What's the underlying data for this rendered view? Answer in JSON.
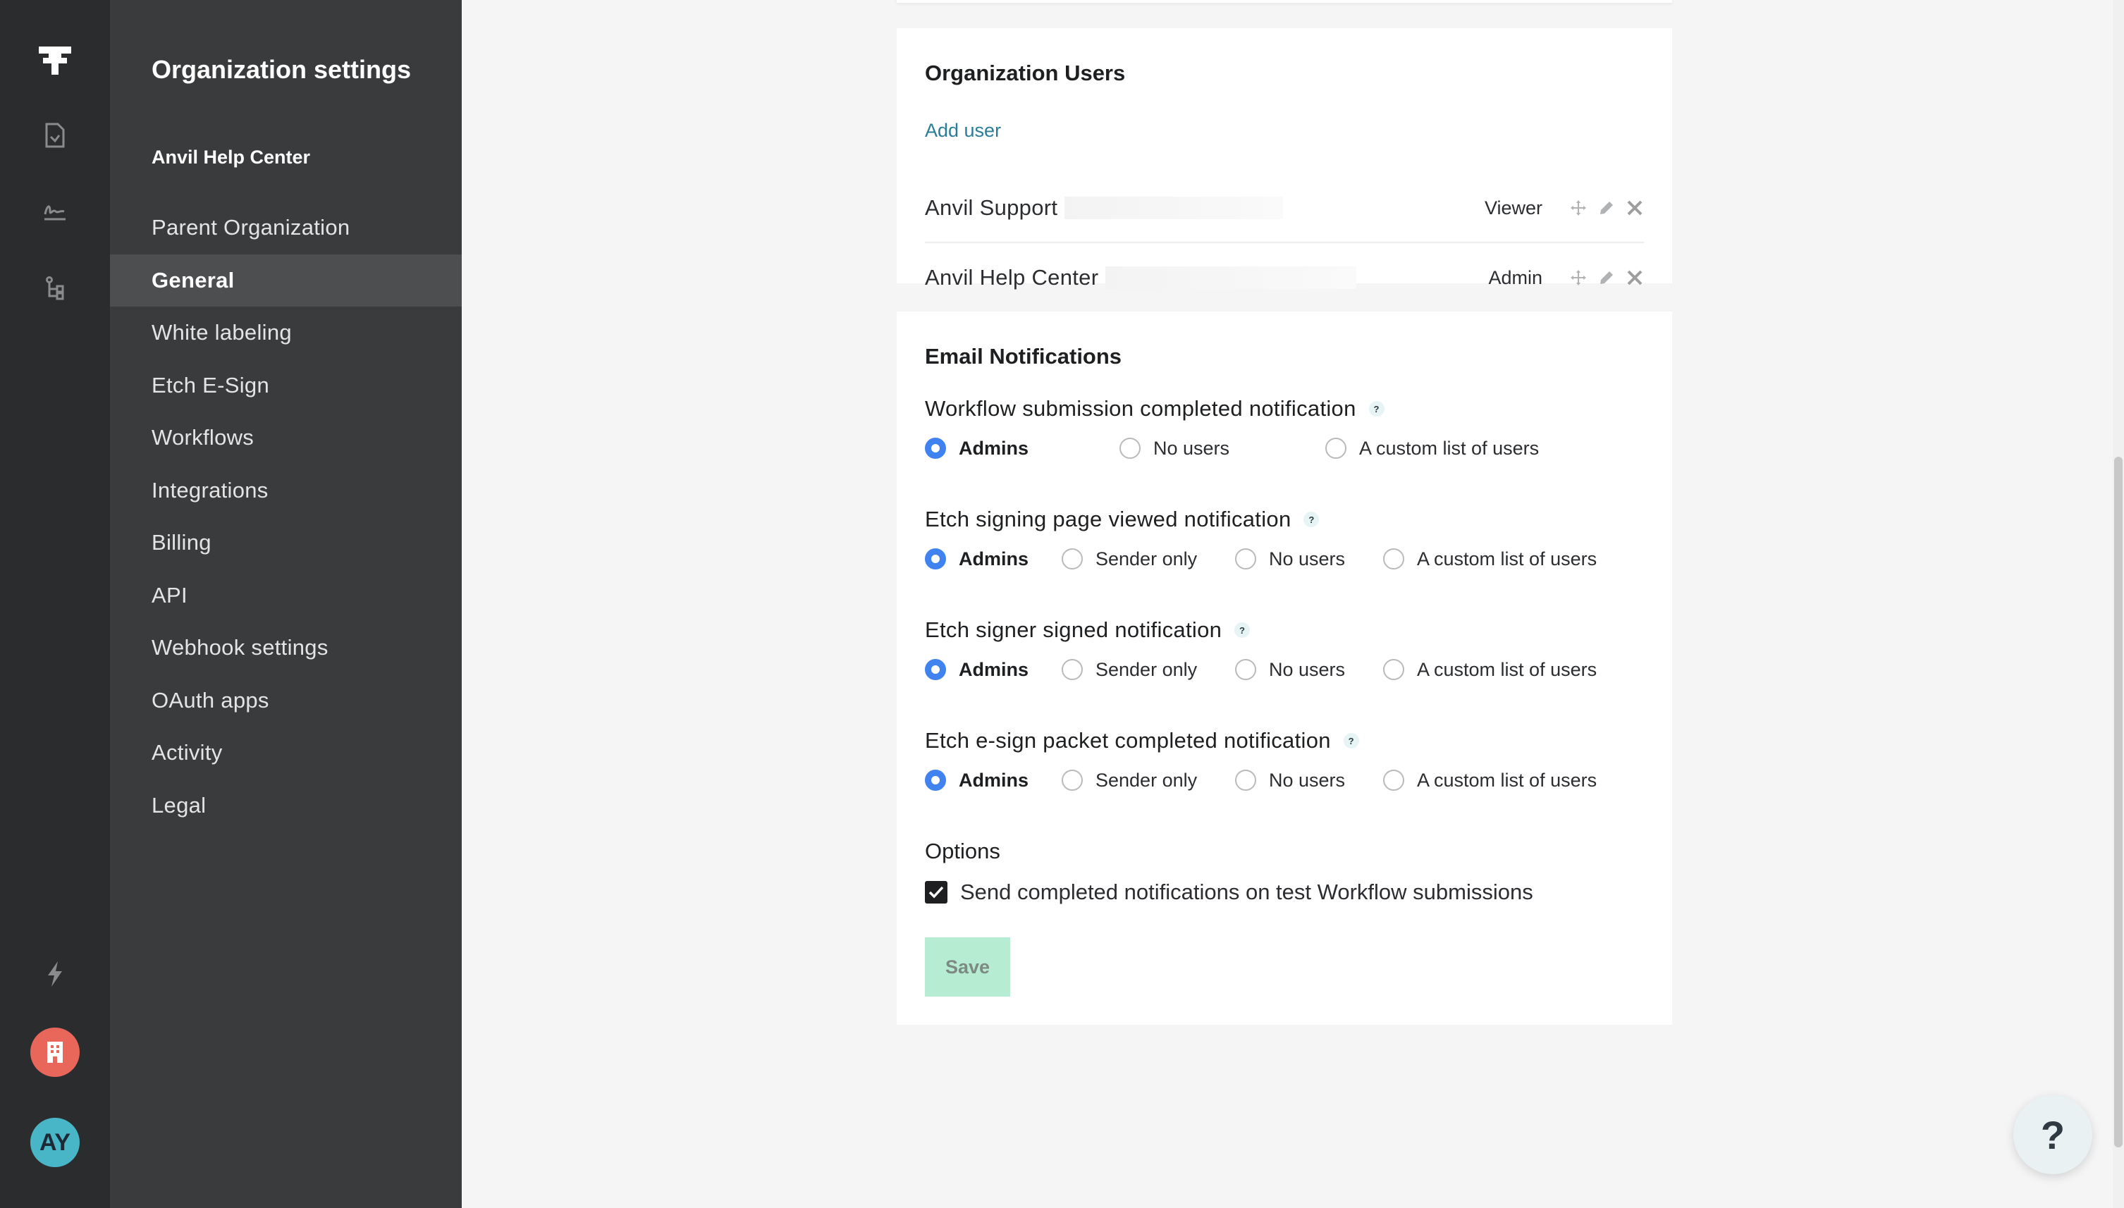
{
  "sidebar": {
    "title": "Organization settings",
    "org_name": "Anvil Help Center",
    "items": [
      {
        "label": "Parent Organization",
        "active": false
      },
      {
        "label": "General",
        "active": true
      },
      {
        "label": "White labeling",
        "active": false
      },
      {
        "label": "Etch E-Sign",
        "active": false
      },
      {
        "label": "Workflows",
        "active": false
      },
      {
        "label": "Integrations",
        "active": false
      },
      {
        "label": "Billing",
        "active": false
      },
      {
        "label": "API",
        "active": false
      },
      {
        "label": "Webhook settings",
        "active": false
      },
      {
        "label": "OAuth apps",
        "active": false
      },
      {
        "label": "Activity",
        "active": false
      },
      {
        "label": "Legal",
        "active": false
      }
    ]
  },
  "rail": {
    "icons": [
      "anvil-logo-icon",
      "document-icon",
      "signature-icon",
      "workflow-tree-icon",
      "lightning-icon",
      "building-icon"
    ],
    "avatar_initials": "AY",
    "colors": {
      "org_badge": "#e8675a",
      "avatar": "#49b6c8"
    }
  },
  "users": {
    "title": "Organization Users",
    "add_user": "Add user",
    "rows": [
      {
        "name": "Anvil Support",
        "role": "Viewer"
      },
      {
        "name": "Anvil Help Center",
        "role": "Admin"
      }
    ]
  },
  "email": {
    "title": "Email Notifications",
    "notifications": [
      {
        "label": "Workflow submission completed notification",
        "options": [
          "Admins",
          "No users",
          "A custom list of users"
        ],
        "selected": "Admins"
      },
      {
        "label": "Etch signing page viewed notification",
        "options": [
          "Admins",
          "Sender only",
          "No users",
          "A custom list of users"
        ],
        "selected": "Admins"
      },
      {
        "label": "Etch signer signed notification",
        "options": [
          "Admins",
          "Sender only",
          "No users",
          "A custom list of users"
        ],
        "selected": "Admins"
      },
      {
        "label": "Etch e-sign packet completed notification",
        "options": [
          "Admins",
          "Sender only",
          "No users",
          "A custom list of users"
        ],
        "selected": "Admins"
      }
    ],
    "help_glyph": "?",
    "options_title": "Options",
    "checkbox_label": "Send completed notifications on test Workflow submissions",
    "checkbox_checked": true,
    "save_label": "Save"
  },
  "help_fab": "?",
  "colors": {
    "accent_radio": "#3f82f0",
    "save_bg": "#b6ecd1",
    "link": "#2a7d96"
  }
}
